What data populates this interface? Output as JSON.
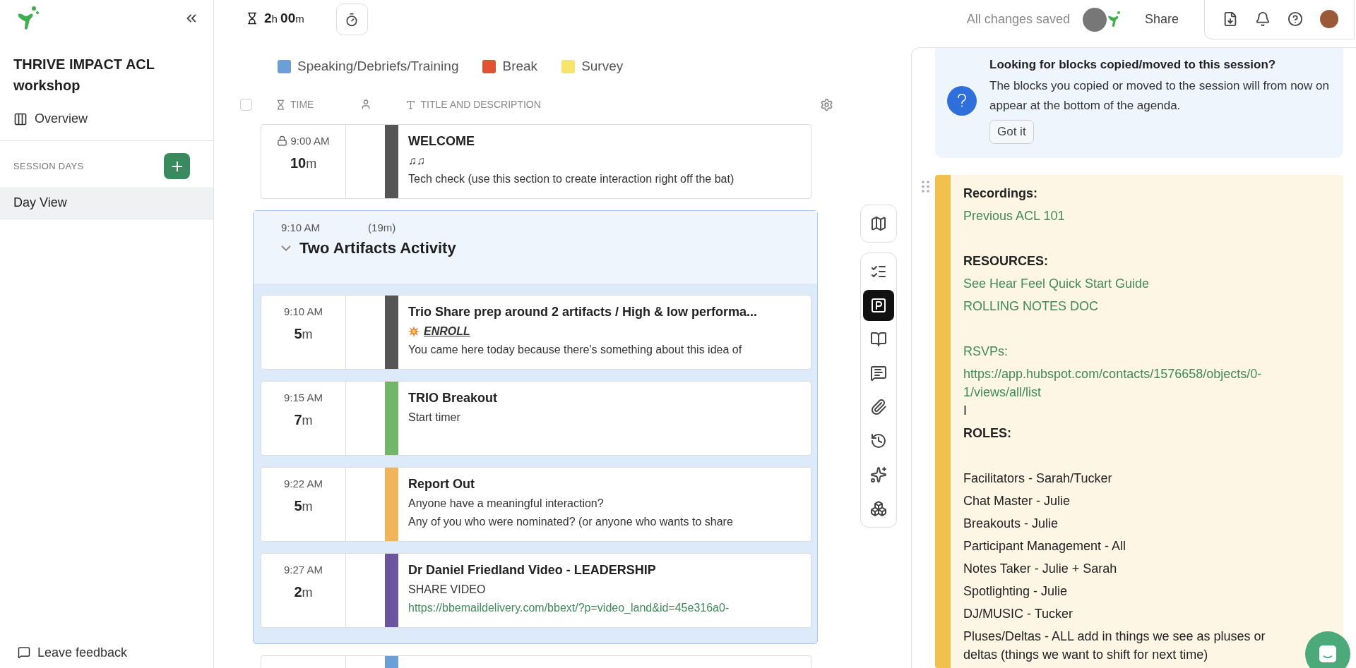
{
  "sidebar": {
    "title": "THRIVE IMPACT ACL workshop",
    "overview": "Overview",
    "section_label": "SESSION DAYS",
    "days": [
      {
        "label": "Day View",
        "selected": true
      }
    ],
    "feedback": "Leave feedback"
  },
  "topbar": {
    "duration": "**2**h **00**m",
    "status": "All changes saved",
    "share": "Share"
  },
  "legend": [
    {
      "label": "Speaking/Debriefs/Training",
      "color": "#6a9fd8"
    },
    {
      "label": "Break",
      "color": "#e0552f"
    },
    {
      "label": "Survey",
      "color": "#f7e56a"
    }
  ],
  "columns": [
    "TIME",
    "TITLE AND DESCRIPTION"
  ],
  "select_all": {
    "checked": false
  },
  "blocks": [
    {
      "kind": "item",
      "time": "9:00 AM",
      "locked": true,
      "duration": "**10**m",
      "color": "#555555",
      "title": "WELCOME",
      "lines": [
        {
          "kind": "text",
          "text": "♫♫"
        },
        {
          "kind": "text",
          "text": "Tech check (use this section to create interaction right off the bat)"
        }
      ]
    },
    {
      "kind": "group",
      "time": "9:10 AM",
      "duration": "(19m)",
      "expanded": true,
      "title": "Two Artifacts Activity",
      "children": [
        {
          "kind": "item",
          "time": "9:10 AM",
          "locked": false,
          "duration": "**5**m",
          "color": "#555555",
          "title": "Trio Share prep around 2 artifacts / High & low performa...",
          "lines": [
            {
              "kind": "emphasis",
              "text": "ENROLL"
            },
            {
              "kind": "text",
              "text": "You came here today because there's something about this idea of"
            }
          ]
        },
        {
          "kind": "item",
          "time": "9:15 AM",
          "locked": false,
          "duration": "**7**m",
          "color": "#72b66a",
          "title": "TRIO Breakout",
          "lines": [
            {
              "kind": "text",
              "text": "Start timer"
            }
          ]
        },
        {
          "kind": "item",
          "time": "9:22 AM",
          "locked": false,
          "duration": "**5**m",
          "color": "#f0b55a",
          "title": "Report Out",
          "lines": [
            {
              "kind": "text",
              "text": "Anyone have a meaningful interaction?"
            },
            {
              "kind": "text",
              "text": "Any of you who were nominated? (or anyone who wants to share"
            }
          ]
        },
        {
          "kind": "item",
          "time": "9:27 AM",
          "locked": false,
          "duration": "**2**m",
          "color": "#6b559e",
          "title": "Dr Daniel Friedland Video - LEADERSHIP",
          "lines": [
            {
              "kind": "text",
              "text": "SHARE VIDEO"
            },
            {
              "kind": "link",
              "text": "https://bbemaildelivery.com/bbext/?p=video_land&id=45e316a0-"
            }
          ]
        }
      ]
    },
    {
      "kind": "item",
      "locked": false,
      "color": "#6a9fd8"
    }
  ],
  "rail": [
    {
      "kind": "checklist",
      "selected": false
    },
    {
      "kind": "parking",
      "selected": true
    },
    {
      "kind": "book",
      "selected": false
    },
    {
      "kind": "comment",
      "selected": false
    },
    {
      "kind": "attachment",
      "selected": false
    },
    {
      "kind": "history",
      "selected": false
    },
    {
      "kind": "sparkles",
      "selected": false
    },
    {
      "kind": "boxes",
      "selected": false
    }
  ],
  "notice": {
    "title": "Looking for blocks copied/moved to this session?",
    "body": "The blocks you copied or moved to the session will from now on appear at the bottom of the agenda.",
    "button": "Got it"
  },
  "notes": {
    "color": "#f2c04c",
    "lines": [
      {
        "kind": "heading",
        "text": "Recordings:"
      },
      {
        "kind": "link",
        "text": "Previous ACL 101"
      },
      {
        "kind": "gap"
      },
      {
        "kind": "heading",
        "text": "RESOURCES:"
      },
      {
        "kind": "link",
        "text": "See Hear Feel Quick Start Guide"
      },
      {
        "kind": "link",
        "text": "ROLLING NOTES DOC"
      },
      {
        "kind": "gap"
      },
      {
        "kind": "link",
        "text": "RSVPs:"
      },
      {
        "kind": "link",
        "text": "https://app.hubspot.com/contacts/1576658/objects/0-1/views/all/list"
      },
      {
        "kind": "text",
        "text": "I"
      },
      {
        "kind": "heading",
        "text": "ROLES:"
      },
      {
        "kind": "gap"
      },
      {
        "kind": "text",
        "text": "Facilitators -  Sarah/Tucker"
      },
      {
        "kind": "text",
        "text": "Chat Master - Julie"
      },
      {
        "kind": "text",
        "text": "Breakouts - Julie"
      },
      {
        "kind": "text",
        "text": "Participant Management -  All"
      },
      {
        "kind": "text",
        "text": "Notes Taker - Julie + Sarah"
      },
      {
        "kind": "text",
        "text": "Spotlighting -  Julie"
      },
      {
        "kind": "text",
        "text": "DJ/MUSIC -  Tucker"
      },
      {
        "kind": "text",
        "text": "Pluses/Deltas - ALL add in things we see as pluses or deltas (things we want to shift for next time)"
      }
    ]
  }
}
